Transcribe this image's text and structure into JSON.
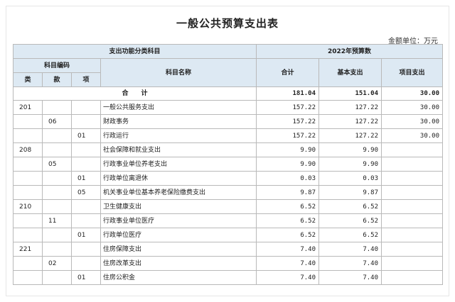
{
  "title": "一般公共预算支出表",
  "unit": "金额单位：万元",
  "header": {
    "function_class": "支出功能分类科目",
    "budget_year": "2022年预算数",
    "subject_code": "科目编码",
    "lei": "类",
    "kuan": "款",
    "xiang": "项",
    "subject_name": "科目名称",
    "total": "合计",
    "basic": "基本支出",
    "project": "项目支出"
  },
  "total_row": {
    "label": "合　　计",
    "total": "181.04",
    "basic": "151.04",
    "project": "30.00"
  },
  "rows": [
    {
      "lei": "201",
      "kuan": "",
      "xiang": "",
      "name": "一般公共服务支出",
      "total": "157.22",
      "basic": "127.22",
      "project": "30.00"
    },
    {
      "lei": "",
      "kuan": "06",
      "xiang": "",
      "name": "财政事务",
      "total": "157.22",
      "basic": "127.22",
      "project": "30.00"
    },
    {
      "lei": "",
      "kuan": "",
      "xiang": "01",
      "name": "行政运行",
      "total": "157.22",
      "basic": "127.22",
      "project": "30.00"
    },
    {
      "lei": "208",
      "kuan": "",
      "xiang": "",
      "name": "社会保障和就业支出",
      "total": "9.90",
      "basic": "9.90",
      "project": ""
    },
    {
      "lei": "",
      "kuan": "05",
      "xiang": "",
      "name": "行政事业单位养老支出",
      "total": "9.90",
      "basic": "9.90",
      "project": ""
    },
    {
      "lei": "",
      "kuan": "",
      "xiang": "01",
      "name": "行政单位离退休",
      "total": "0.03",
      "basic": "0.03",
      "project": ""
    },
    {
      "lei": "",
      "kuan": "",
      "xiang": "05",
      "name": "机关事业单位基本养老保险缴费支出",
      "total": "9.87",
      "basic": "9.87",
      "project": ""
    },
    {
      "lei": "210",
      "kuan": "",
      "xiang": "",
      "name": "卫生健康支出",
      "total": "6.52",
      "basic": "6.52",
      "project": ""
    },
    {
      "lei": "",
      "kuan": "11",
      "xiang": "",
      "name": "行政事业单位医疗",
      "total": "6.52",
      "basic": "6.52",
      "project": ""
    },
    {
      "lei": "",
      "kuan": "",
      "xiang": "01",
      "name": "行政单位医疗",
      "total": "6.52",
      "basic": "6.52",
      "project": ""
    },
    {
      "lei": "221",
      "kuan": "",
      "xiang": "",
      "name": "住房保障支出",
      "total": "7.40",
      "basic": "7.40",
      "project": ""
    },
    {
      "lei": "",
      "kuan": "02",
      "xiang": "",
      "name": "住房改革支出",
      "total": "7.40",
      "basic": "7.40",
      "project": ""
    },
    {
      "lei": "",
      "kuan": "",
      "xiang": "01",
      "name": "住房公积金",
      "total": "7.40",
      "basic": "7.40",
      "project": ""
    }
  ]
}
